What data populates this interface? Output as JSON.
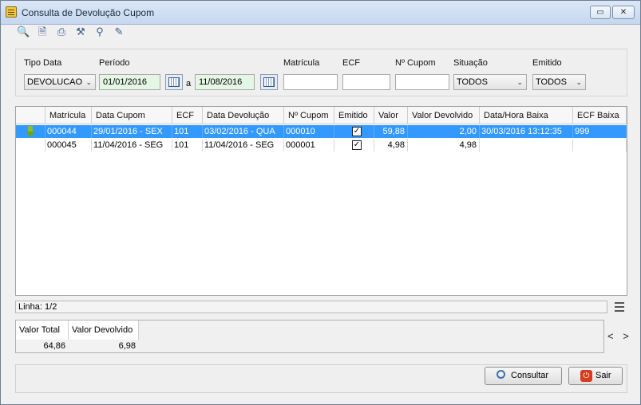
{
  "window": {
    "title": "Consulta de Devolução Cupom",
    "restore_label": "▭",
    "close_label": "✕"
  },
  "toolbar": {
    "icons": [
      "search-icon",
      "new-document-icon",
      "print-icon",
      "tools-icon",
      "key-icon",
      "edit-icon"
    ]
  },
  "filters": {
    "tipo_data": {
      "label": "Tipo Data",
      "value": "DEVOLUCAO"
    },
    "periodo": {
      "label": "Período",
      "start": "01/01/2016",
      "separator": "a",
      "end": "11/08/2016"
    },
    "matricula": {
      "label": "Matrícula",
      "value": ""
    },
    "ecf": {
      "label": "ECF",
      "value": ""
    },
    "num_cupom": {
      "label": "Nº Cupom",
      "value": ""
    },
    "situacao": {
      "label": "Situação",
      "value": "TODOS"
    },
    "emitido": {
      "label": "Emitido",
      "value": "TODOS"
    }
  },
  "grid": {
    "columns": [
      "Matrícula",
      "Data Cupom",
      "ECF",
      "Data Devolução",
      "Nº Cupom",
      "Emitido",
      "Valor",
      "Valor Devolvido",
      "Data/Hora Baixa",
      "ECF Baixa"
    ],
    "rows": [
      {
        "matricula": "000044",
        "data_cupom": "29/01/2016 - SEX",
        "ecf": "101",
        "data_devolucao": "03/02/2016 - QUA",
        "num_cupom": "000010",
        "emitido": true,
        "valor": "59,88",
        "valor_devolvido": "2,00",
        "data_hora_baixa": "30/03/2016 13:12:35",
        "ecf_baixa": "999",
        "selected": true
      },
      {
        "matricula": "000045",
        "data_cupom": "11/04/2016 - SEG",
        "ecf": "101",
        "data_devolucao": "11/04/2016 - SEG",
        "num_cupom": "000001",
        "emitido": true,
        "valor": "4,98",
        "valor_devolvido": "4,98",
        "data_hora_baixa": "",
        "ecf_baixa": "",
        "selected": false
      }
    ]
  },
  "status": {
    "linha": "Linha: 1/2"
  },
  "totals": {
    "valor_total_label": "Valor Total",
    "valor_total": "64,86",
    "valor_devolvido_label": "Valor Devolvido",
    "valor_devolvido": "6,98",
    "nav": "< >"
  },
  "buttons": {
    "consultar": "Consultar",
    "sair": "Sair"
  }
}
